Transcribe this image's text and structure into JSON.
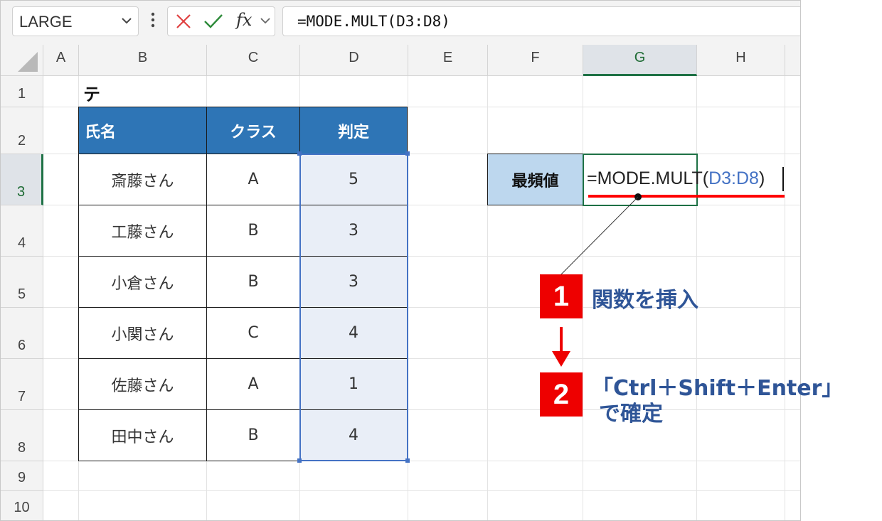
{
  "formula_bar": {
    "name_box": "LARGE",
    "fx_label": "fx",
    "formula": "=MODE.MULT(D3:D8)"
  },
  "columns": [
    "A",
    "B",
    "C",
    "D",
    "E",
    "F",
    "G",
    "H"
  ],
  "selected_column": "G",
  "rows": [
    "1",
    "2",
    "3",
    "4",
    "5",
    "6",
    "7",
    "8",
    "9",
    "10"
  ],
  "selected_row": "3",
  "sheet": {
    "title": "テスト結果",
    "headers": [
      "氏名",
      "クラス",
      "判定"
    ],
    "data": [
      {
        "name": "斎藤さん",
        "class": "A",
        "score": "5"
      },
      {
        "name": "工藤さん",
        "class": "B",
        "score": "3"
      },
      {
        "name": "小倉さん",
        "class": "B",
        "score": "3"
      },
      {
        "name": "小関さん",
        "class": "C",
        "score": "4"
      },
      {
        "name": "佐藤さん",
        "class": "A",
        "score": "1"
      },
      {
        "name": "田中さん",
        "class": "B",
        "score": "4"
      }
    ],
    "mode_label": "最頻値",
    "active_formula": {
      "prefix": "=MODE.MULT(",
      "ref": "D3:D8",
      "suffix": ")"
    }
  },
  "annotations": {
    "step1": {
      "number": "1",
      "text": "関数を挿入"
    },
    "step2": {
      "number": "2",
      "line1": "「Ctrl＋Shift＋Enter」",
      "line2": "で確定"
    }
  },
  "colors": {
    "header_fill": "#2e75b6",
    "label_fill": "#bdd7ee",
    "selection": "#4472c4",
    "active_border": "#1e7145",
    "accent_red": "#ee0000",
    "annotation_text": "#2f5597"
  }
}
